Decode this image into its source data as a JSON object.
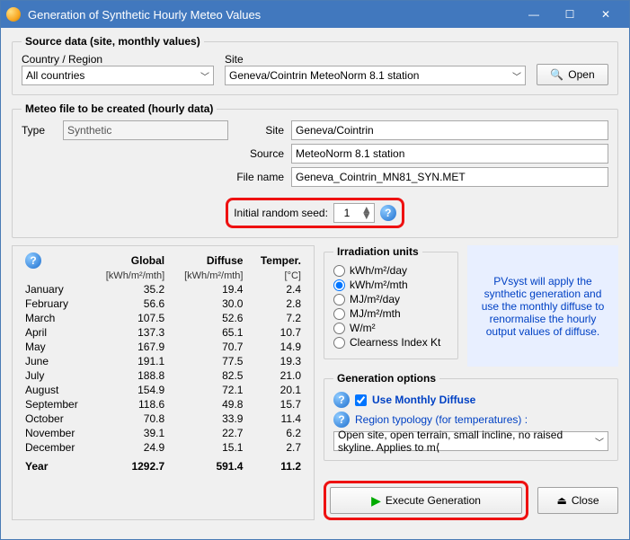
{
  "window": {
    "title": "Generation of Synthetic Hourly Meteo Values"
  },
  "source": {
    "legend": "Source data (site, monthly values)",
    "country_label": "Country / Region",
    "country_value": "All countries",
    "site_label": "Site",
    "site_value": "Geneva/Cointrin       MeteoNorm 8.1 station",
    "open_label": "Open"
  },
  "target": {
    "legend": "Meteo file to be created (hourly data)",
    "type_label": "Type",
    "type_value": "Synthetic",
    "site_label": "Site",
    "site_value": "Geneva/Cointrin",
    "source_label": "Source",
    "source_value": "MeteoNorm 8.1 station",
    "filename_label": "File name",
    "filename_value": "Geneva_Cointrin_MN81_SYN.MET",
    "seed_label": "Initial random seed:",
    "seed_value": "1"
  },
  "table": {
    "headers": {
      "c1": "",
      "c2": "Global",
      "c3": "Diffuse",
      "c4": "Temper."
    },
    "units": {
      "c2": "[kWh/m²/mth]",
      "c3": "[kWh/m²/mth]",
      "c4": "[°C]"
    },
    "rows": [
      {
        "m": "January",
        "g": "35.2",
        "d": "19.4",
        "t": "2.4"
      },
      {
        "m": "February",
        "g": "56.6",
        "d": "30.0",
        "t": "2.8"
      },
      {
        "m": "March",
        "g": "107.5",
        "d": "52.6",
        "t": "7.2"
      },
      {
        "m": "April",
        "g": "137.3",
        "d": "65.1",
        "t": "10.7"
      },
      {
        "m": "May",
        "g": "167.9",
        "d": "70.7",
        "t": "14.9"
      },
      {
        "m": "June",
        "g": "191.1",
        "d": "77.5",
        "t": "19.3"
      },
      {
        "m": "July",
        "g": "188.8",
        "d": "82.5",
        "t": "21.0"
      },
      {
        "m": "August",
        "g": "154.9",
        "d": "72.1",
        "t": "20.1"
      },
      {
        "m": "September",
        "g": "118.6",
        "d": "49.8",
        "t": "15.7"
      },
      {
        "m": "October",
        "g": "70.8",
        "d": "33.9",
        "t": "11.4"
      },
      {
        "m": "November",
        "g": "39.1",
        "d": "22.7",
        "t": "6.2"
      },
      {
        "m": "December",
        "g": "24.9",
        "d": "15.1",
        "t": "2.7"
      }
    ],
    "total": {
      "m": "Year",
      "g": "1292.7",
      "d": "591.4",
      "t": "11.2"
    }
  },
  "irrad": {
    "legend": "Irradiation units",
    "options": [
      "kWh/m²/day",
      "kWh/m²/mth",
      "MJ/m²/day",
      "MJ/m²/mth",
      "W/m²",
      "Clearness Index Kt"
    ],
    "selected": "kWh/m²/mth"
  },
  "hint": "PVsyst will apply the synthetic generation and use the monthly diffuse to renormalise the hourly output values of diffuse.",
  "genopts": {
    "legend": "Generation options",
    "use_diffuse_label": "Use Monthly Diffuse",
    "typology_label": "Region typology (for temperatures) :",
    "typology_value": "Open site, open terrain, small incline, no raised skyline. Applies to m⟨"
  },
  "buttons": {
    "execute": "Execute Generation",
    "close": "Close"
  }
}
